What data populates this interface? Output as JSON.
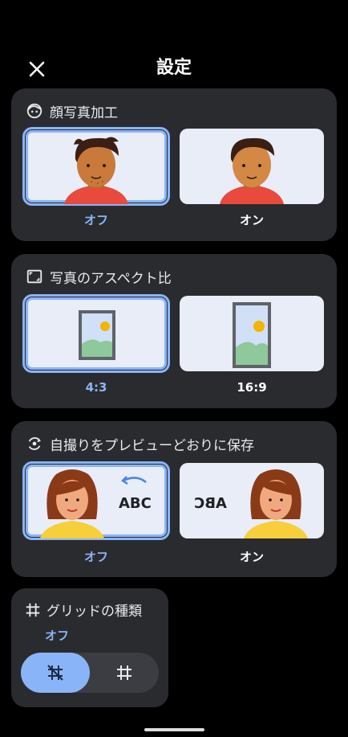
{
  "header": {
    "title": "設定",
    "close_icon": "close-icon"
  },
  "face_retouch": {
    "title": "顔写真加工",
    "icon": "face-retouch-icon",
    "options": [
      {
        "label": "オフ",
        "selected": true
      },
      {
        "label": "オン",
        "selected": false
      }
    ]
  },
  "aspect_ratio": {
    "title": "写真のアスペクト比",
    "icon": "aspect-ratio-icon",
    "options": [
      {
        "label": "4:3",
        "selected": true
      },
      {
        "label": "16:9",
        "selected": false
      }
    ]
  },
  "mirror_selfie": {
    "title": "自撮りをプレビューどおりに保存",
    "icon": "flip-camera-icon",
    "sample_text": "ABC",
    "options": [
      {
        "label": "オフ",
        "selected": true
      },
      {
        "label": "オン",
        "selected": false
      }
    ]
  },
  "grid": {
    "title": "グリッドの種類",
    "value": "オフ",
    "icon": "grid-icon",
    "toggle": [
      {
        "icon": "grid-off-icon",
        "selected": true
      },
      {
        "icon": "grid-icon",
        "selected": false
      }
    ]
  },
  "colors": {
    "accent": "#8ab4f8",
    "card": "#2a2b2f",
    "background": "#000000"
  }
}
